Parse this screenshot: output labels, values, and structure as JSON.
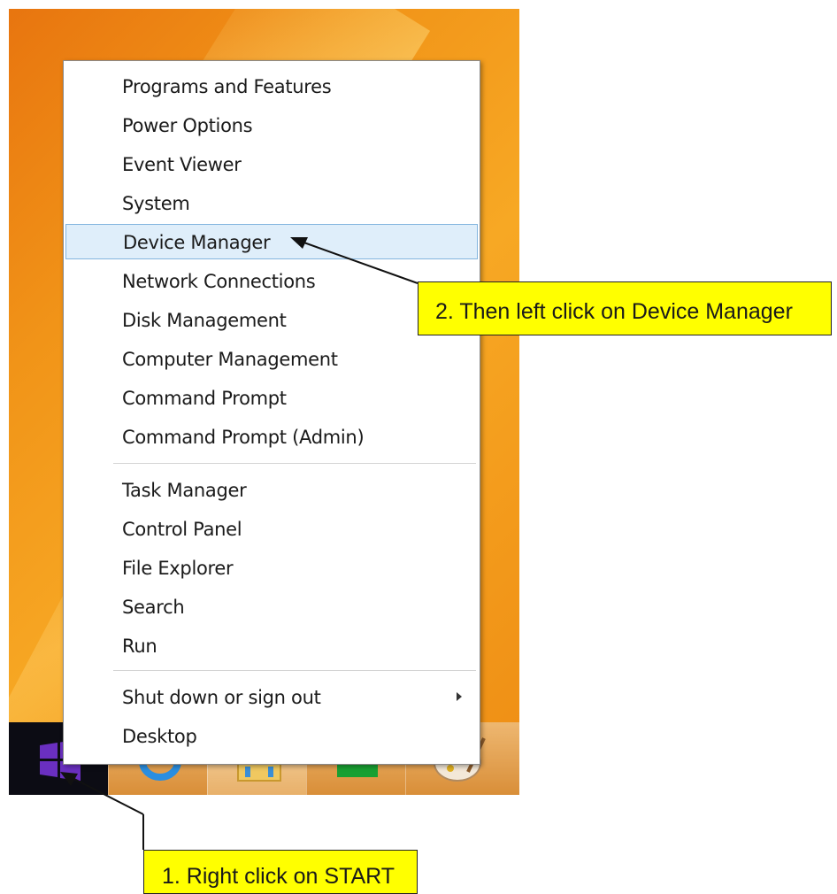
{
  "context_menu": {
    "items": [
      {
        "label": "Programs and Features"
      },
      {
        "label": "Power Options"
      },
      {
        "label": "Event Viewer"
      },
      {
        "label": "System"
      },
      {
        "label": "Device Manager",
        "highlighted": true
      },
      {
        "label": "Network Connections"
      },
      {
        "label": "Disk Management"
      },
      {
        "label": "Computer Management"
      },
      {
        "label": "Command Prompt"
      },
      {
        "label": "Command Prompt (Admin)"
      },
      {
        "label": "Task Manager"
      },
      {
        "label": "Control Panel"
      },
      {
        "label": "File Explorer"
      },
      {
        "label": "Search"
      },
      {
        "label": "Run"
      },
      {
        "label": "Shut down or sign out",
        "has_submenu": true
      },
      {
        "label": "Desktop"
      }
    ]
  },
  "taskbar": {
    "buttons": [
      {
        "icon": "windows-start-icon"
      },
      {
        "icon": "internet-explorer-icon"
      },
      {
        "icon": "file-explorer-icon"
      },
      {
        "icon": "windows-store-icon"
      },
      {
        "icon": "paint-icon"
      }
    ]
  },
  "callouts": {
    "step1": "1. Right click on START",
    "step2": "2. Then left click on Device Manager"
  },
  "colors": {
    "callout_bg": "#ffff00",
    "highlight_bg": "#dfeefa",
    "highlight_border": "#82b4de",
    "start_logo": "#6a2fc0"
  }
}
